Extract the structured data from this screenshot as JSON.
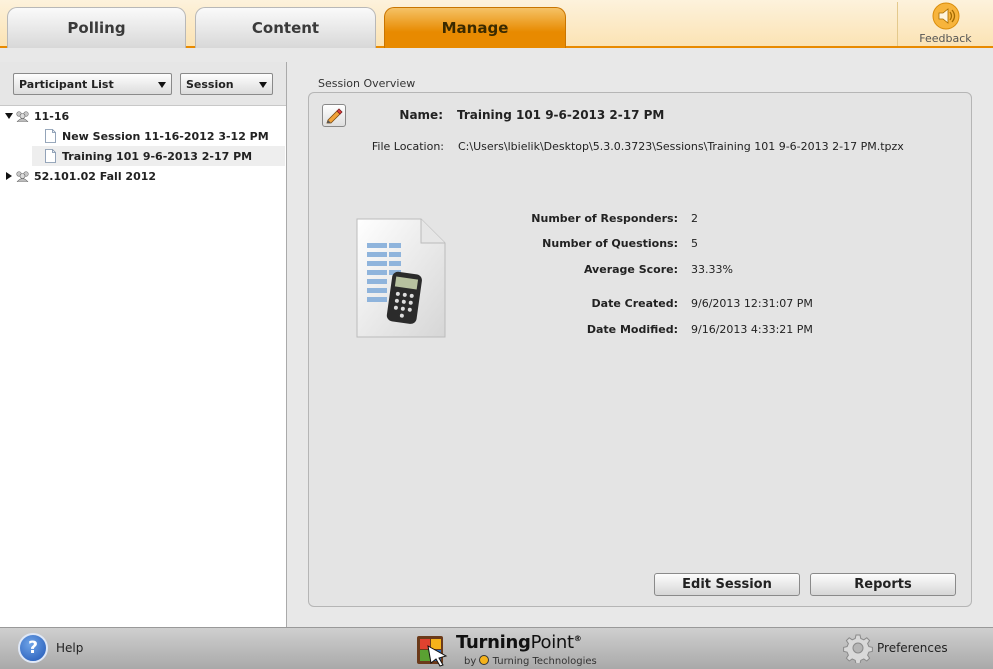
{
  "tabs": [
    {
      "label": "Polling"
    },
    {
      "label": "Content"
    },
    {
      "label": "Manage",
      "active": true
    }
  ],
  "feedback": {
    "label": "Feedback",
    "icon": "speaker-icon"
  },
  "left": {
    "dropdown_list": {
      "value": "Participant List"
    },
    "dropdown_session": {
      "value": "Session"
    },
    "tree": [
      {
        "label": "11-16",
        "expanded": true,
        "icon": "group-icon"
      },
      {
        "label": "New Session 11-16-2012 3-12 PM",
        "icon": "document-icon"
      },
      {
        "label": "Training 101 9-6-2013 2-17 PM",
        "icon": "document-icon",
        "selected": true
      },
      {
        "label": "52.101.02 Fall 2012",
        "expanded": false,
        "icon": "group-icon"
      }
    ]
  },
  "overview": {
    "section_title": "Session Overview",
    "name_label": "Name:",
    "name_value": "Training 101 9-6-2013 2-17 PM",
    "file_location_label": "File Location:",
    "file_location_value": "C:\\Users\\lbielik\\Desktop\\5.3.0.3723\\Sessions\\Training 101 9-6-2013 2-17 PM.tpzx",
    "stats": [
      {
        "label": "Number of Responders:",
        "value": "2"
      },
      {
        "label": "Number of Questions:",
        "value": "5"
      },
      {
        "label": "Average Score:",
        "value": "33.33%"
      },
      {
        "label": "Date Created:",
        "value": "9/6/2013 12:31:07 PM"
      },
      {
        "label": "Date Modified:",
        "value": "9/16/2013 4:33:21 PM"
      }
    ],
    "edit_session_label": "Edit Session",
    "reports_label": "Reports"
  },
  "bottom": {
    "help_label": "Help",
    "brand_turning": "Turning",
    "brand_point": "Point",
    "brand_reg": "®",
    "brand_by": "by",
    "brand_company": "Turning Technologies",
    "preferences_label": "Preferences"
  },
  "colors": {
    "accent": "#e88a00",
    "panel": "#e4e4e4",
    "help_blue": "#1f55b4"
  }
}
